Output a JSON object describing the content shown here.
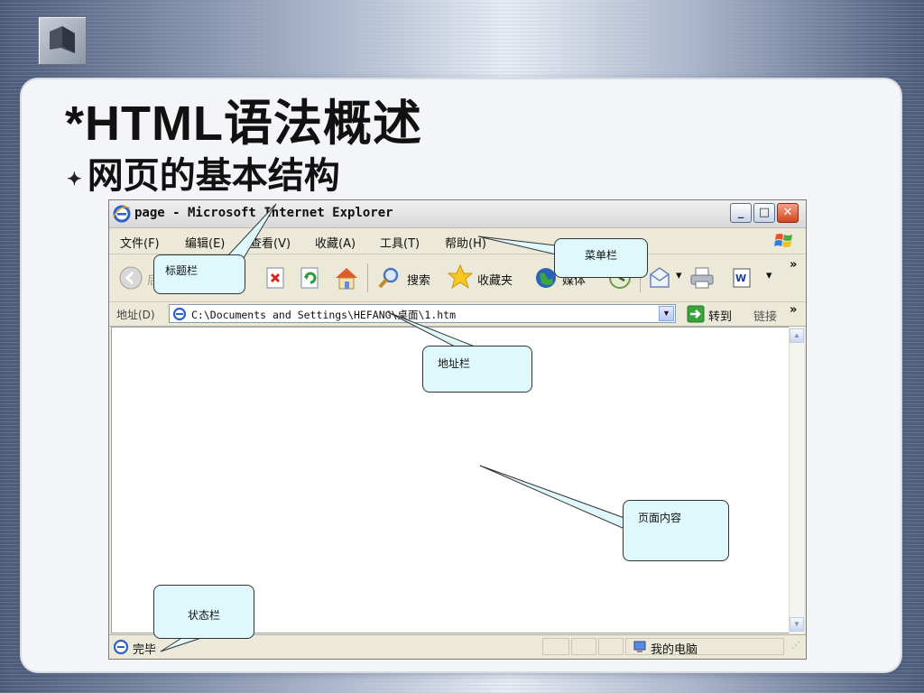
{
  "slide": {
    "title": "*HTML语法概述",
    "bullet": "网页的基本结构",
    "bullet_symbol": "✦"
  },
  "window": {
    "title": "page - Microsoft Internet Explorer",
    "menu": [
      "文件(F)",
      "编辑(E)",
      "查看(V)",
      "收藏(A)",
      "工具(T)",
      "帮助(H)"
    ],
    "toolbar": {
      "back": "后退",
      "search": "搜索",
      "favorites": "收藏夹",
      "media": "媒体"
    },
    "address": {
      "label": "地址(D)",
      "value": "C:\\Documents and Settings\\HEFANG\\桌面\\1.htm",
      "go": "转到",
      "links": "链接"
    },
    "status": {
      "text": "完毕",
      "zone": "我的电脑"
    }
  },
  "callouts": {
    "title_bar": "标题栏",
    "menu_bar": "菜单栏",
    "address_bar": "地址栏",
    "page_content": "页面内容",
    "status_bar": "状态栏"
  },
  "colors": {
    "callout_fill": "#dff8fb",
    "panel": "#f4f5f9",
    "window_chrome": "#ece9d8"
  }
}
